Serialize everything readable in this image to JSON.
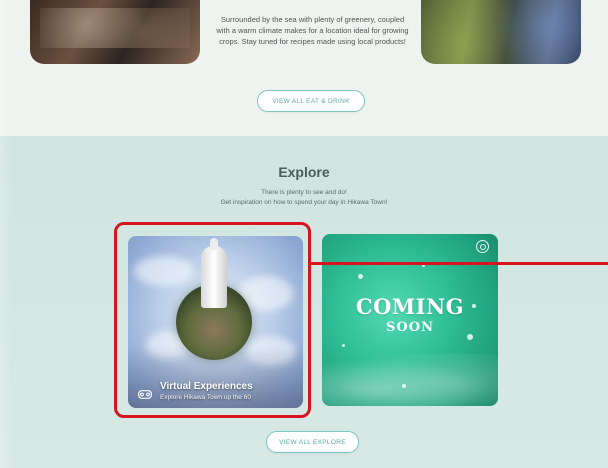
{
  "eat_drink": {
    "description": "Surrounded by the sea with plenty of greenery, coupled with a warm climate makes for a location ideal for growing crops. Stay tuned for recipes made using local products!",
    "button_label": "VIEW ALL EAT & DRINK"
  },
  "explore": {
    "title": "Explore",
    "description_line1": "There is plenty to see and do!",
    "description_line2": "Get inspiration on how to spend your day in Hikawa Town!",
    "cards": [
      {
        "title": "Virtual Experiences",
        "subtitle": "Explore Hikawa Town up the 60",
        "icon": "vr-headset-icon"
      },
      {
        "coming_line1": "COMING",
        "coming_line2": "SOON",
        "icon": "badge-icon"
      }
    ],
    "button_label": "VIEW ALL EXPLORE"
  },
  "colors": {
    "accent_teal": "#5aa9a6",
    "highlight_red": "#d8141e",
    "coming_soon_green": "#2fbf97"
  }
}
